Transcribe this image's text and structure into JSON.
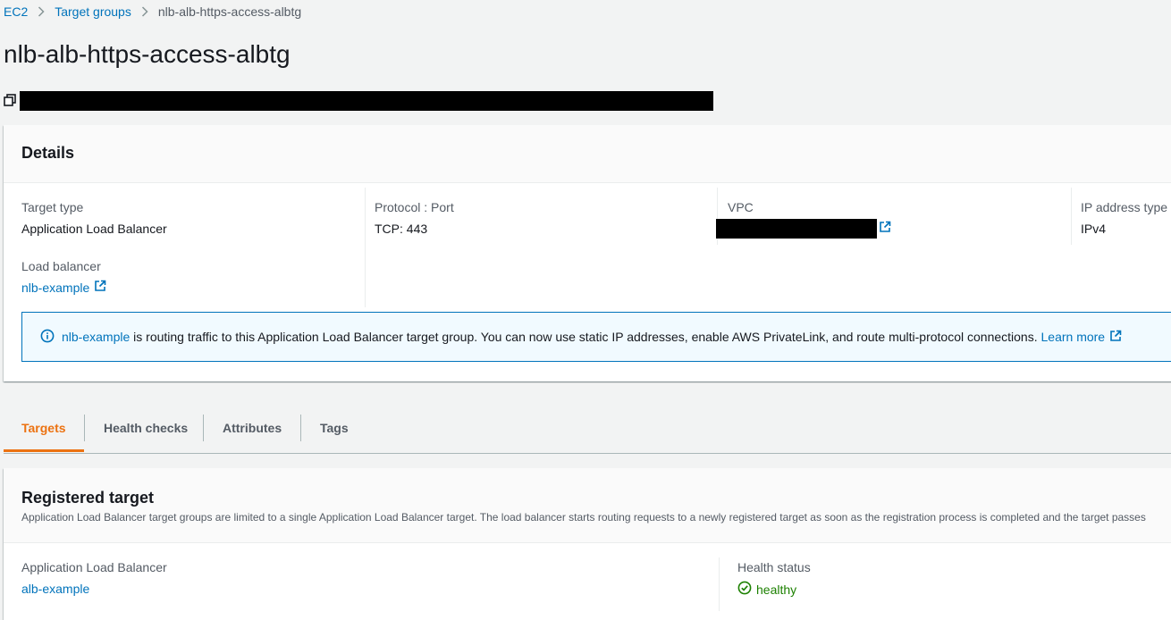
{
  "breadcrumb": {
    "items": [
      "EC2",
      "Target groups"
    ],
    "current": "nlb-alb-https-access-albtg"
  },
  "page": {
    "title": "nlb-alb-https-access-albtg"
  },
  "details": {
    "title": "Details",
    "target_type_label": "Target type",
    "target_type_value": "Application Load Balancer",
    "protocol_port_label": "Protocol : Port",
    "protocol_port_value": "TCP: 443",
    "vpc_label": "VPC",
    "ip_type_label": "IP address type",
    "ip_type_value": "IPv4",
    "load_balancer_label": "Load balancer",
    "load_balancer_value": "nlb-example"
  },
  "info_alert": {
    "link_text": "nlb-example",
    "message": " is routing traffic to this Application Load Balancer target group. You can now use static IP addresses, enable AWS PrivateLink, and route multi-protocol connections. ",
    "learn_more": "Learn more"
  },
  "tabs": [
    {
      "label": "Targets",
      "active": true
    },
    {
      "label": "Health checks",
      "active": false
    },
    {
      "label": "Attributes",
      "active": false
    },
    {
      "label": "Tags",
      "active": false
    }
  ],
  "registered_target": {
    "title": "Registered target",
    "description": "Application Load Balancer target groups are limited to a single Application Load Balancer target. The load balancer starts routing requests to a newly registered target as soon as the registration process is completed and the target passes",
    "alb_label": "Application Load Balancer",
    "alb_value": "alb-example",
    "health_label": "Health status",
    "health_value": "healthy"
  },
  "colors": {
    "link": "#0073bb",
    "active_tab": "#ec7211",
    "healthy": "#1d8102",
    "info_border": "#0073bb",
    "info_bg": "#f1faff"
  },
  "icons": [
    "chevron-right-icon",
    "copy-icon",
    "external-link-icon",
    "info-icon",
    "check-circle-icon"
  ]
}
